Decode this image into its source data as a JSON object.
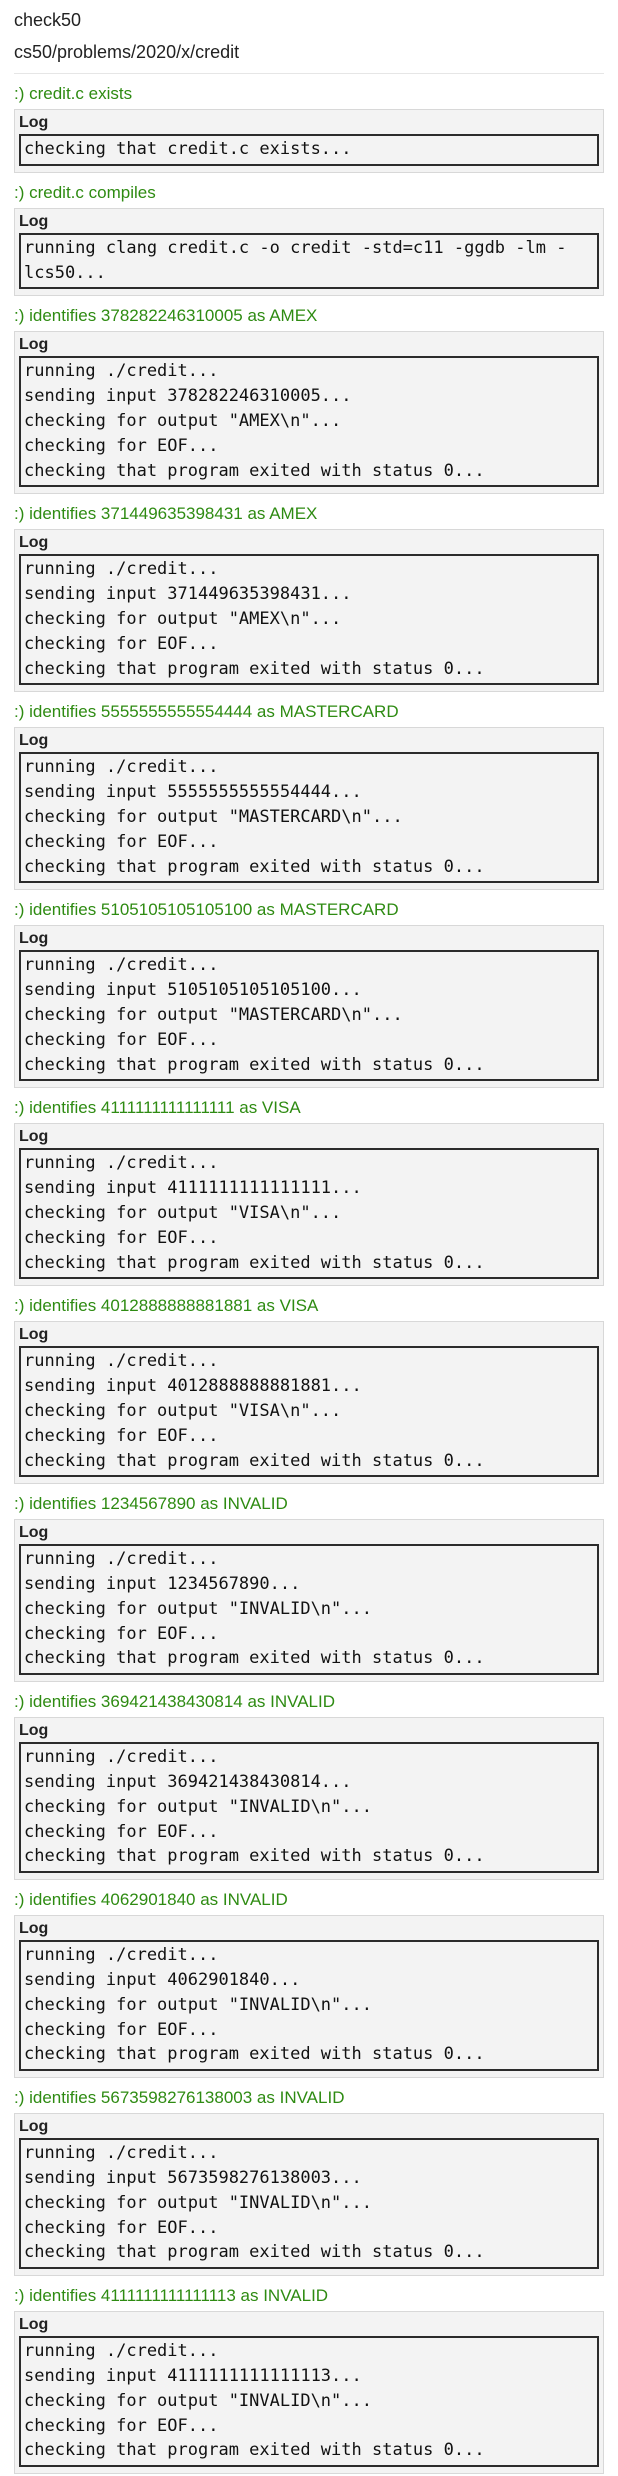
{
  "header": {
    "app_name": "check50",
    "slug": "cs50/problems/2020/x/credit"
  },
  "log_label": "Log",
  "colors": {
    "pass_green": "#2e8b12",
    "log_background": "#f3f3f3",
    "log_border": "#2b2b2b"
  },
  "checks": [
    {
      "title": ":) credit.c exists",
      "log": [
        "checking that credit.c exists..."
      ]
    },
    {
      "title": ":) credit.c compiles",
      "log": [
        "running clang credit.c -o credit -std=c11 -ggdb -lm -lcs50..."
      ]
    },
    {
      "title": ":) identifies 378282246310005 as AMEX",
      "log": [
        "running ./credit...",
        "sending input 378282246310005...",
        "checking for output \"AMEX\\n\"...",
        "checking for EOF...",
        "checking that program exited with status 0..."
      ]
    },
    {
      "title": ":) identifies 371449635398431 as AMEX",
      "log": [
        "running ./credit...",
        "sending input 371449635398431...",
        "checking for output \"AMEX\\n\"...",
        "checking for EOF...",
        "checking that program exited with status 0..."
      ]
    },
    {
      "title": ":) identifies 5555555555554444 as MASTERCARD",
      "log": [
        "running ./credit...",
        "sending input 5555555555554444...",
        "checking for output \"MASTERCARD\\n\"...",
        "checking for EOF...",
        "checking that program exited with status 0..."
      ]
    },
    {
      "title": ":) identifies 5105105105105100 as MASTERCARD",
      "log": [
        "running ./credit...",
        "sending input 5105105105105100...",
        "checking for output \"MASTERCARD\\n\"...",
        "checking for EOF...",
        "checking that program exited with status 0..."
      ]
    },
    {
      "title": ":) identifies 4111111111111111 as VISA",
      "log": [
        "running ./credit...",
        "sending input 4111111111111111...",
        "checking for output \"VISA\\n\"...",
        "checking for EOF...",
        "checking that program exited with status 0..."
      ]
    },
    {
      "title": ":) identifies 4012888888881881 as VISA",
      "log": [
        "running ./credit...",
        "sending input 4012888888881881...",
        "checking for output \"VISA\\n\"...",
        "checking for EOF...",
        "checking that program exited with status 0..."
      ]
    },
    {
      "title": ":) identifies 1234567890 as INVALID",
      "log": [
        "running ./credit...",
        "sending input 1234567890...",
        "checking for output \"INVALID\\n\"...",
        "checking for EOF...",
        "checking that program exited with status 0..."
      ]
    },
    {
      "title": ":) identifies 369421438430814 as INVALID",
      "log": [
        "running ./credit...",
        "sending input 369421438430814...",
        "checking for output \"INVALID\\n\"...",
        "checking for EOF...",
        "checking that program exited with status 0..."
      ]
    },
    {
      "title": ":) identifies 4062901840 as INVALID",
      "log": [
        "running ./credit...",
        "sending input 4062901840...",
        "checking for output \"INVALID\\n\"...",
        "checking for EOF...",
        "checking that program exited with status 0..."
      ]
    },
    {
      "title": ":) identifies 5673598276138003 as INVALID",
      "log": [
        "running ./credit...",
        "sending input 5673598276138003...",
        "checking for output \"INVALID\\n\"...",
        "checking for EOF...",
        "checking that program exited with status 0..."
      ]
    },
    {
      "title": ":) identifies 4111111111111113 as INVALID",
      "log": [
        "running ./credit...",
        "sending input 4111111111111113...",
        "checking for output \"INVALID\\n\"...",
        "checking for EOF...",
        "checking that program exited with status 0..."
      ]
    }
  ]
}
